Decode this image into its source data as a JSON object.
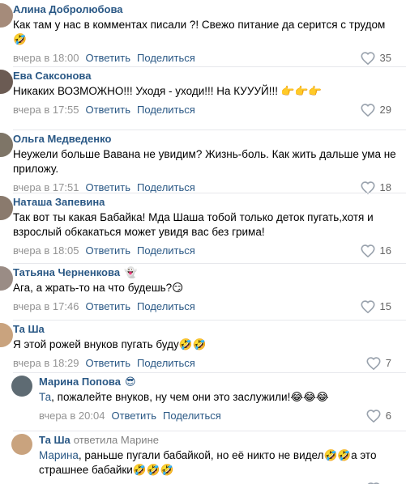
{
  "colors": {
    "link": "#2a5885",
    "meta": "#939393",
    "divider": "#e7e8ec",
    "reply_background": "#ffffff"
  },
  "comments": [
    {
      "author": "Алина Добролюбова",
      "badge": "",
      "replied_to": "",
      "mention": "",
      "text": "Как там у нас в комментах писали ?! Свежо питание да серится с трудом 🤣",
      "time": "вчера в 18:00",
      "reply_label": "Ответить",
      "share_label": "Поделиться",
      "likes": "35",
      "avatar_color": "#a58b7a",
      "is_reply": false
    },
    {
      "author": "Ева Саксонова",
      "badge": "",
      "replied_to": "",
      "mention": "",
      "text": "Никаких ВОЗМОЖНО!!! Уходя - уходи!!! На КУУУЙ!!! 👉👉👉",
      "time": "вчера в 17:55",
      "reply_label": "Ответить",
      "share_label": "Поделиться",
      "likes": "29",
      "avatar_color": "#6b5b53",
      "is_reply": false
    },
    {
      "author": "Ольга Медведенко",
      "badge": "",
      "replied_to": "",
      "mention": "",
      "text": "Неужели больше Вавана не увидим? Жизнь-боль. Как жить дальше ума не приложу.",
      "time": "вчера в 17:51",
      "reply_label": "Ответить",
      "share_label": "Поделиться",
      "likes": "18",
      "avatar_color": "#7e7567",
      "is_reply": false
    },
    {
      "author": "Наташа Запевина",
      "badge": "",
      "replied_to": "",
      "mention": "",
      "text": "Так вот ты какая Бабайка! Мда Шаша тобой только деток пугать,хотя и взрослый обкакаться может увидя вас без грима!",
      "time": "вчера в 18:05",
      "reply_label": "Ответить",
      "share_label": "Поделиться",
      "likes": "16",
      "avatar_color": "#8a7a6d",
      "is_reply": false
    },
    {
      "author": "Татьяна Черненкова",
      "badge": "👻",
      "replied_to": "",
      "mention": "",
      "text": "Ага, а жрать-то на что будешь?😏",
      "time": "вчера в 17:46",
      "reply_label": "Ответить",
      "share_label": "Поделиться",
      "likes": "15",
      "avatar_color": "#9a8c85",
      "is_reply": false
    },
    {
      "author": "Та Ша",
      "badge": "",
      "replied_to": "",
      "mention": "",
      "text": "Я этой рожей внуков пугать буду🤣🤣",
      "time": "вчера в 18:29",
      "reply_label": "Ответить",
      "share_label": "Поделиться",
      "likes": "7",
      "avatar_color": "#c9a37e",
      "is_reply": false
    },
    {
      "author": "Марина Попова",
      "badge": "😎",
      "replied_to": "",
      "mention": "Та",
      "text": ", пожалейте внуков, ну чем они это заслужили!😂😂😂",
      "time": "вчера в 20:04",
      "reply_label": "Ответить",
      "share_label": "Поделиться",
      "likes": "6",
      "avatar_color": "#5e6b73",
      "is_reply": true
    },
    {
      "author": "Та Ша",
      "badge": "",
      "replied_to": "ответила Марине",
      "mention": "Марина",
      "text": ", раньше пугали бабайкой, но её никто не видел🤣🤣а это страшнее бабайки🤣🤣🤣",
      "time": "вчера в 20:12",
      "reply_label": "Ответить",
      "share_label": "Поделиться",
      "likes": "5",
      "avatar_color": "#c9a37e",
      "is_reply": true
    }
  ]
}
